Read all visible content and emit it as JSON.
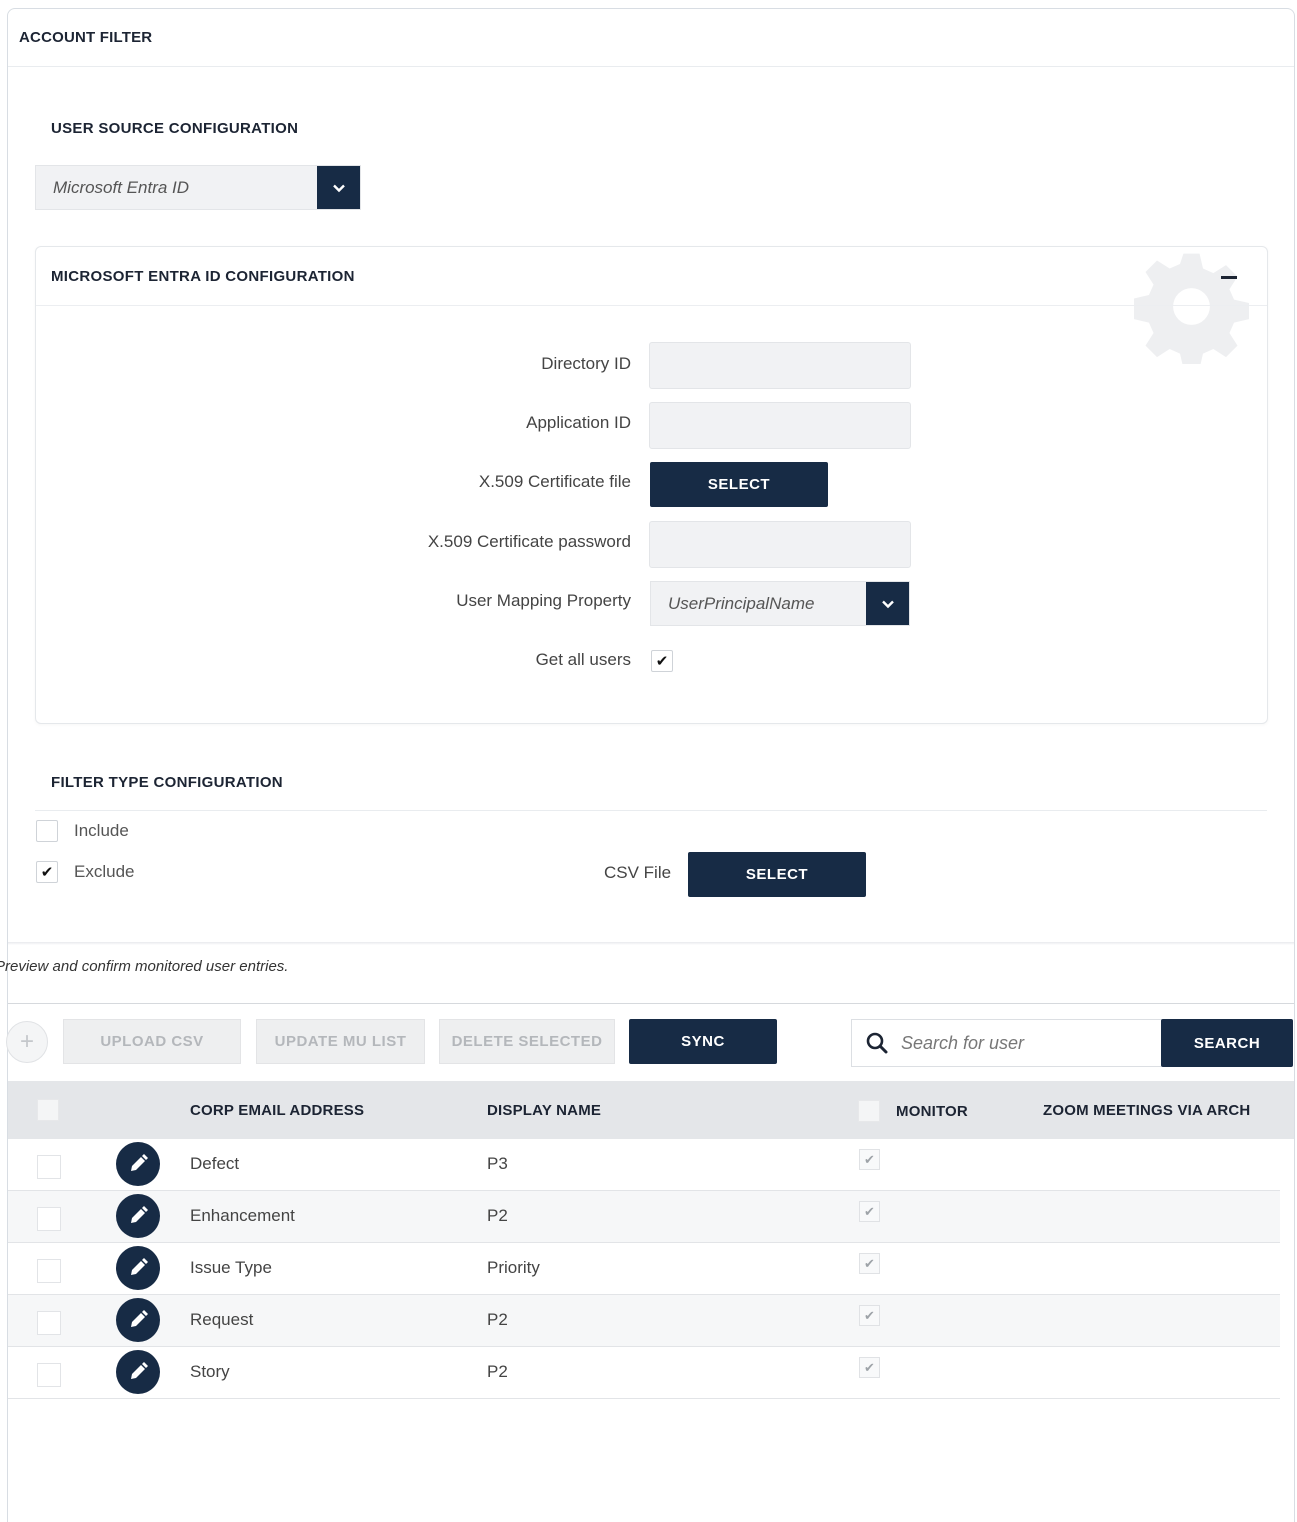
{
  "panel": {
    "title": "ACCOUNT FILTER"
  },
  "user_source": {
    "title": "USER SOURCE CONFIGURATION",
    "selected": "Microsoft Entra ID"
  },
  "entra_config": {
    "title": "MICROSOFT ENTRA ID CONFIGURATION",
    "directory_id_label": "Directory ID",
    "directory_id_value": "",
    "application_id_label": "Application ID",
    "application_id_value": "",
    "cert_file_label": "X.509 Certificate file",
    "cert_file_button": "SELECT",
    "cert_password_label": "X.509 Certificate password",
    "cert_password_value": "",
    "mapping_label": "User Mapping Property",
    "mapping_selected": "UserPrincipalName",
    "get_all_users_label": "Get all users",
    "get_all_users_checked": true
  },
  "filter_type": {
    "title": "FILTER TYPE CONFIGURATION",
    "include_label": "Include",
    "include_checked": false,
    "exclude_label": "Exclude",
    "exclude_checked": true,
    "csv_label": "CSV File",
    "csv_button": "SELECT"
  },
  "preview": {
    "text": "Preview and confirm monitored user entries."
  },
  "toolbar": {
    "add_label": "+",
    "upload_csv": "UPLOAD CSV",
    "update_mu_list": "UPDATE MU LIST",
    "delete_selected": "DELETE SELECTED",
    "sync": "SYNC",
    "search_placeholder": "Search for user",
    "search_button": "SEARCH"
  },
  "table": {
    "columns": [
      "CORP EMAIL ADDRESS",
      "DISPLAY NAME",
      "MONITOR",
      "ZOOM MEETINGS VIA ARCH"
    ],
    "rows": [
      {
        "email": "Defect",
        "display_name": "P3",
        "monitor": true
      },
      {
        "email": "Enhancement",
        "display_name": "P2",
        "monitor": true
      },
      {
        "email": "Issue Type",
        "display_name": "Priority",
        "monitor": true
      },
      {
        "email": "Request",
        "display_name": "P2",
        "monitor": true
      },
      {
        "email": "Story",
        "display_name": "P2",
        "monitor": true
      }
    ]
  },
  "colors": {
    "primary": "#172b45",
    "disabled_bg": "#eeeff0",
    "header_bg": "#e4e6e9"
  }
}
